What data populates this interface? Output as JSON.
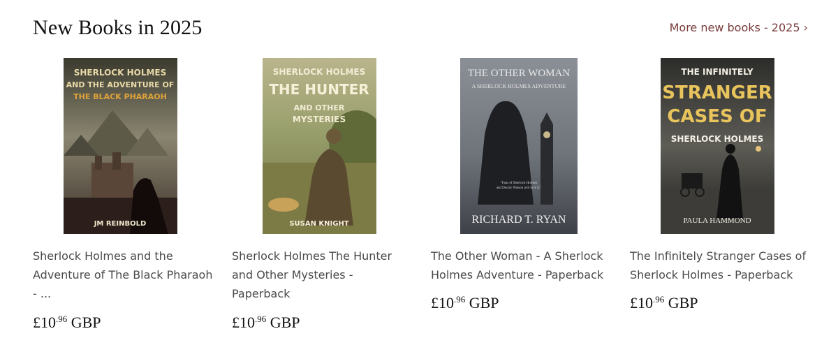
{
  "header": {
    "title": "New Books in 2025",
    "more_link": "More new books - 2025 ›"
  },
  "colors": {
    "link": "#7a3b3b",
    "title": "#111111",
    "text": "#4a4a4a"
  },
  "books": [
    {
      "title": "Sherlock Holmes and the Adventure of The Black Pharaoh - ...",
      "cover_lines": [
        "SHERLOCK HOLMES",
        "AND THE ADVENTURE OF",
        "THE BLACK PHARAOH"
      ],
      "cover_author": "JM REINBOLD",
      "price_currency": "£10",
      "price_pence": ".96",
      "price_code": "GBP"
    },
    {
      "title": "Sherlock Holmes The Hunter and Other Mysteries - Paperback",
      "cover_lines": [
        "SHERLOCK HOLMES",
        "THE HUNTER",
        "AND OTHER",
        "MYSTERIES"
      ],
      "cover_author": "SUSAN KNIGHT",
      "price_currency": "£10",
      "price_pence": ".96",
      "price_code": "GBP"
    },
    {
      "title": "The Other Woman - A Sherlock Holmes Adventure - Paperback",
      "cover_lines": [
        "THE OTHER WOMAN",
        "A SHERLOCK HOLMES ADVENTURE"
      ],
      "cover_quote": [
        "\"Fans of Sherlock Holmes",
        "and Doctor Watson will love it.\""
      ],
      "cover_author": "RICHARD T. RYAN",
      "price_currency": "£10",
      "price_pence": ".96",
      "price_code": "GBP"
    },
    {
      "title": "The Infinitely Stranger Cases of Sherlock Holmes - Paperback",
      "cover_lines": [
        "THE INFINITELY",
        "STRANGER",
        "CASES OF",
        "SHERLOCK HOLMES"
      ],
      "cover_author": "PAULA HAMMOND",
      "price_currency": "£10",
      "price_pence": ".96",
      "price_code": "GBP"
    }
  ]
}
